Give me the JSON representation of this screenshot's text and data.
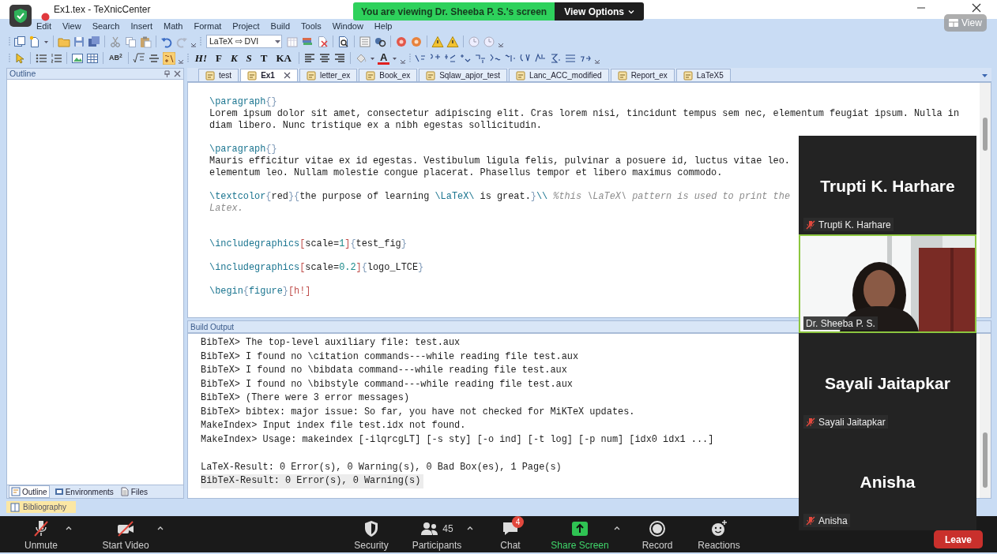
{
  "window": {
    "title": "Ex1.tex - TeXnicCenter"
  },
  "share_banner": {
    "text": "You are viewing Dr. Sheeba P. S.'s screen",
    "view_options": "View Options"
  },
  "view_button": "View",
  "menu": [
    "Edit",
    "View",
    "Search",
    "Insert",
    "Math",
    "Format",
    "Project",
    "Build",
    "Tools",
    "Window",
    "Help"
  ],
  "toolbar": {
    "compiler": "LaTeX ⇨ DVI",
    "superscript_button": "AB$^{2}$",
    "format_buttons": [
      "H!",
      "F",
      "K",
      "S",
      "T",
      "KA"
    ],
    "font_color_button": "A"
  },
  "outline_pane": {
    "title": "Outline",
    "tabs": [
      {
        "label": "Outline",
        "selected": true
      },
      {
        "label": "Environments",
        "selected": false
      },
      {
        "label": "Files",
        "selected": false
      }
    ],
    "bottom_tab": "Bibliography"
  },
  "document_tabs": [
    {
      "label": "test",
      "selected": false
    },
    {
      "label": "Ex1",
      "selected": true
    },
    {
      "label": "letter_ex",
      "selected": false
    },
    {
      "label": "Book_ex",
      "selected": false
    },
    {
      "label": "Sqlaw_apjor_test",
      "selected": false
    },
    {
      "label": "Lanc_ACC_modified",
      "selected": false
    },
    {
      "label": "Report_ex",
      "selected": false
    },
    {
      "label": "LaTeX5",
      "selected": false
    }
  ],
  "editor": {
    "lines": [
      {
        "kind": "code",
        "segments": [
          {
            "kind": "command",
            "text": "\\paragraph"
          },
          {
            "kind": "brace",
            "text": "{}"
          }
        ]
      },
      {
        "kind": "code",
        "segments": [
          {
            "kind": "text",
            "text": "Lorem ipsum dolor sit amet, consectetur adipiscing elit. Cras lorem nisi, tincidunt tempus sem nec, elementum feugiat ipsum. Nulla in"
          }
        ]
      },
      {
        "kind": "code",
        "segments": [
          {
            "kind": "text",
            "text": "diam libero. Nunc tristique ex a nibh egestas sollicitudin."
          }
        ]
      },
      {
        "kind": "blank"
      },
      {
        "kind": "code",
        "segments": [
          {
            "kind": "command",
            "text": "\\paragraph"
          },
          {
            "kind": "brace",
            "text": "{}"
          }
        ]
      },
      {
        "kind": "code",
        "segments": [
          {
            "kind": "text",
            "text": "Mauris efficitur vitae ex id egestas. Vestibulum ligula felis, pulvinar a posuere id, luctus vitae leo."
          }
        ]
      },
      {
        "kind": "code",
        "segments": [
          {
            "kind": "text",
            "text": "elementum leo. Nullam molestie congue placerat. Phasellus tempor et libero maximus commodo."
          }
        ]
      },
      {
        "kind": "blank"
      },
      {
        "kind": "code",
        "segments": [
          {
            "kind": "command",
            "text": "\\textcolor"
          },
          {
            "kind": "brace",
            "text": "{"
          },
          {
            "kind": "text",
            "text": "red"
          },
          {
            "kind": "brace",
            "text": "}{"
          },
          {
            "kind": "text",
            "text": "the purpose of learning "
          },
          {
            "kind": "command",
            "text": "\\LaTeX\\"
          },
          {
            "kind": "text",
            "text": " is great."
          },
          {
            "kind": "brace",
            "text": "}"
          },
          {
            "kind": "command",
            "text": "\\\\"
          },
          {
            "kind": "comment",
            "text": " %this \\LaTeX\\ pattern is used to print the"
          }
        ]
      },
      {
        "kind": "code",
        "segments": [
          {
            "kind": "comment",
            "text": "Latex."
          }
        ]
      },
      {
        "kind": "blank"
      },
      {
        "kind": "blank"
      },
      {
        "kind": "code",
        "segments": [
          {
            "kind": "command",
            "text": "\\includegraphics"
          },
          {
            "kind": "bracket",
            "text": "["
          },
          {
            "kind": "text",
            "text": "scale="
          },
          {
            "kind": "number",
            "text": "1"
          },
          {
            "kind": "bracket",
            "text": "]"
          },
          {
            "kind": "brace",
            "text": "{"
          },
          {
            "kind": "text",
            "text": "test_fig"
          },
          {
            "kind": "brace",
            "text": "}"
          }
        ]
      },
      {
        "kind": "blank"
      },
      {
        "kind": "code",
        "segments": [
          {
            "kind": "command",
            "text": "\\includegraphics"
          },
          {
            "kind": "bracket",
            "text": "["
          },
          {
            "kind": "text",
            "text": "scale="
          },
          {
            "kind": "number",
            "text": "0.2"
          },
          {
            "kind": "bracket",
            "text": "]"
          },
          {
            "kind": "brace",
            "text": "{"
          },
          {
            "kind": "text",
            "text": "logo_LTCE"
          },
          {
            "kind": "brace",
            "text": "}"
          }
        ]
      },
      {
        "kind": "blank"
      },
      {
        "kind": "code",
        "segments": [
          {
            "kind": "command",
            "text": "\\begin"
          },
          {
            "kind": "brace",
            "text": "{"
          },
          {
            "kind": "command",
            "text": "figure"
          },
          {
            "kind": "brace",
            "text": "}"
          },
          {
            "kind": "bracket",
            "text": "[h!]"
          }
        ]
      }
    ]
  },
  "build_output": {
    "title": "Build Output",
    "lines": [
      {
        "kind": "text",
        "text": "BibTeX> The top-level auxiliary file: test.aux",
        "highlighted": false
      },
      {
        "kind": "text",
        "text": "BibTeX> I found no \\citation commands---while reading file test.aux",
        "highlighted": false
      },
      {
        "kind": "text",
        "text": "BibTeX> I found no \\bibdata command---while reading file test.aux",
        "highlighted": false
      },
      {
        "kind": "text",
        "text": "BibTeX> I found no \\bibstyle command---while reading file test.aux",
        "highlighted": false
      },
      {
        "kind": "text",
        "text": "BibTeX> (There were 3 error messages)",
        "highlighted": false
      },
      {
        "kind": "text",
        "text": "BibTeX> bibtex: major issue: So far, you have not checked for MiKTeX updates.",
        "highlighted": false
      },
      {
        "kind": "text",
        "text": "MakeIndex> Input index file test.idx not found.",
        "highlighted": false
      },
      {
        "kind": "text",
        "text": "MakeIndex> Usage: makeindex [-ilqrcgLT] [-s sty] [-o ind] [-t log] [-p num] [idx0 idx1 ...]",
        "highlighted": false
      },
      {
        "kind": "blank"
      },
      {
        "kind": "text",
        "text": "LaTeX-Result: 0 Error(s), 0 Warning(s), 0 Bad Box(es), 1 Page(s)",
        "highlighted": false
      },
      {
        "kind": "text",
        "text": "BibTeX-Result: 0 Error(s), 0 Warning(s)",
        "highlighted": true
      }
    ]
  },
  "participants": [
    {
      "kind": "name_tile",
      "display_name": "Trupti K. Harhare",
      "label": "Trupti K. Harhare",
      "muted": true,
      "speaking": false
    },
    {
      "kind": "video",
      "label": "Dr. Sheeba P. S.",
      "muted": false,
      "speaking": true
    },
    {
      "kind": "name_tile",
      "display_name": "Sayali Jaitapkar",
      "label": "Sayali Jaitapkar",
      "muted": true,
      "speaking": false
    },
    {
      "kind": "name_tile",
      "display_name": "Anisha",
      "label": "Anisha",
      "muted": true,
      "speaking": false
    }
  ],
  "audio_video_controls": [
    {
      "kind": "mic_muted",
      "label": "Unmute",
      "caret": true
    },
    {
      "kind": "video_off",
      "label": "Start Video",
      "caret": true
    }
  ],
  "meeting_controls": [
    {
      "kind": "security",
      "label": "Security",
      "caret": false
    },
    {
      "kind": "participants",
      "label": "Participants",
      "count": "45",
      "caret": true
    },
    {
      "kind": "chat",
      "label": "Chat",
      "badge": "4",
      "caret": false
    },
    {
      "kind": "share",
      "label": "Share Screen",
      "caret": true
    },
    {
      "kind": "record",
      "label": "Record",
      "caret": false
    },
    {
      "kind": "reactions",
      "label": "Reactions",
      "caret": false
    }
  ],
  "leave_button": "Leave"
}
